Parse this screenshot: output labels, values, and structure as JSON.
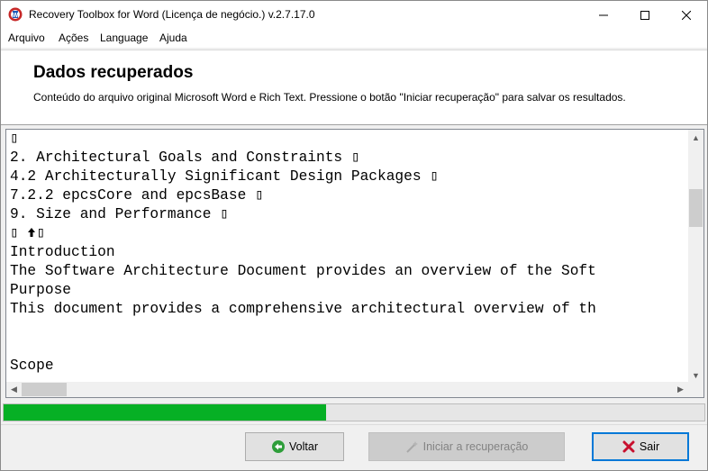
{
  "window": {
    "title": "Recovery Toolbox for Word (Licença de negócio.) v.2.7.17.0"
  },
  "menu": {
    "items": [
      {
        "label": "Arquivo"
      },
      {
        "label": "Ações"
      },
      {
        "label": "Language"
      },
      {
        "label": "Ajuda"
      }
    ]
  },
  "header": {
    "title": "Dados recuperados",
    "description": "Conteúdo do arquivo original Microsoft Word e Rich Text. Pressione o botão \"Iniciar recuperação\" para salvar os resultados."
  },
  "content": {
    "lines": [
      "",
      "2. Architectural Goals and Constraints ",
      "4.2 Architecturally Significant Design Packages ",
      "7.2.2 epcsCore and epcsBase ",
      "9. Size and Performance ",
      " ",
      "Introduction",
      "The Software Architecture Document provides an overview of the Soft",
      "Purpose",
      "This document provides a comprehensive architectural overview of th",
      "",
      "",
      "Scope"
    ]
  },
  "progress": {
    "fraction": 0.46,
    "color": "#06b025"
  },
  "buttons": {
    "back": "Voltar",
    "start": "Iniciar a recuperação",
    "exit": "Sair"
  }
}
